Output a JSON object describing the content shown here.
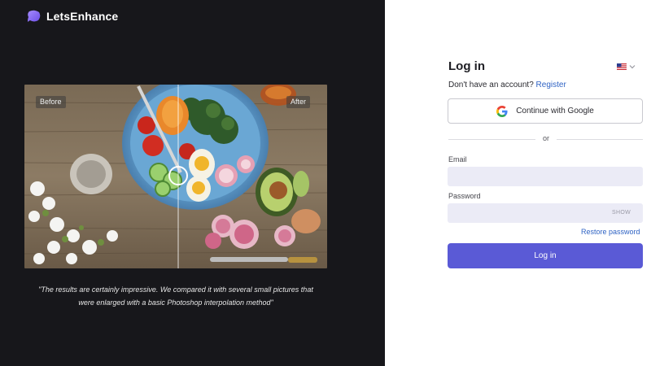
{
  "brand": {
    "name": "LetsEnhance"
  },
  "showcase": {
    "before_label": "Before",
    "after_label": "After",
    "quote_line1": "\"The results are certainly impressive. We compared it with several small pictures that",
    "quote_line2": "were enlarged with a basic Photoshop interpolation method\""
  },
  "login": {
    "title": "Log in",
    "language_icon": "us-flag-icon",
    "signup_prompt": "Don't have an account?",
    "signup_link": "Register",
    "google_button": "Continue with Google",
    "divider_text": "or",
    "email_label": "Email",
    "email_value": "",
    "password_label": "Password",
    "password_value": "",
    "show_label": "SHOW",
    "restore_link": "Restore password",
    "submit_label": "Log in"
  },
  "colors": {
    "left_panel": "#17171b",
    "accent": "#5a5ad6",
    "link": "#2f63c4",
    "input_bg": "#ebebf6",
    "brand_logo": "#8b6cf2"
  }
}
